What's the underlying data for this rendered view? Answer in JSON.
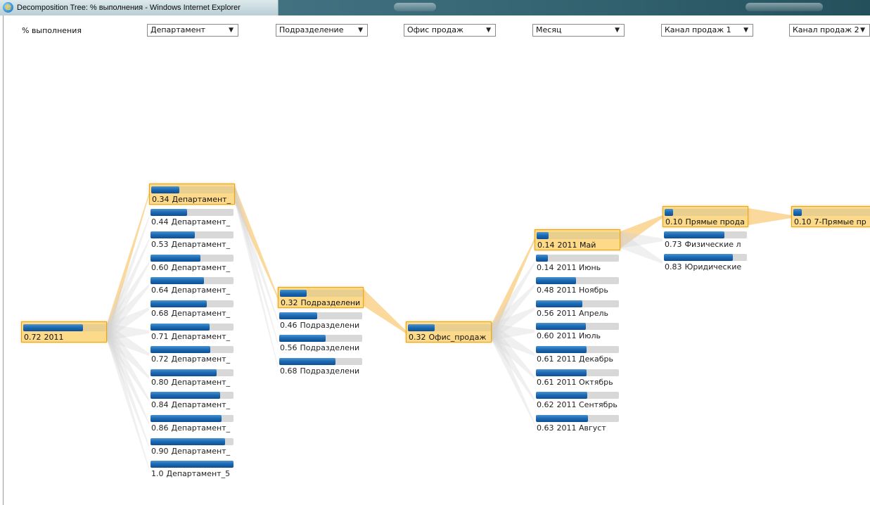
{
  "window": {
    "title": "Decomposition Tree: % выполнения - Windows Internet Explorer",
    "icon": "ie-icon"
  },
  "levels": {
    "measure_label": "% выполнения",
    "dropdowns": [
      {
        "selected": "Департамент"
      },
      {
        "selected": "Подразделение"
      },
      {
        "selected": "Офис продаж"
      },
      {
        "selected": "Месяц"
      },
      {
        "selected": "Канал продаж 1"
      },
      {
        "selected": "Канал продаж 2"
      }
    ]
  },
  "colors": {
    "bar_fill": "#1d6cb4",
    "selected_bg": "#fdd98a",
    "selected_border": "#e9a514",
    "link_selected": "#f7b84a",
    "link_other": "#d4d4d4"
  },
  "tree": {
    "columns": [
      {
        "nodes": [
          {
            "value": "0.72",
            "label": "2011",
            "fraction": 0.72,
            "selected": true
          }
        ]
      },
      {
        "nodes": [
          {
            "value": "0.34",
            "label": "Департамент_",
            "fraction": 0.34,
            "selected": true
          },
          {
            "value": "0.44",
            "label": "Департамент_",
            "fraction": 0.44
          },
          {
            "value": "0.53",
            "label": "Департамент_",
            "fraction": 0.53
          },
          {
            "value": "0.60",
            "label": "Департамент_",
            "fraction": 0.6
          },
          {
            "value": "0.64",
            "label": "Департамент_",
            "fraction": 0.64
          },
          {
            "value": "0.68",
            "label": "Департамент_",
            "fraction": 0.68
          },
          {
            "value": "0.71",
            "label": "Департамент_",
            "fraction": 0.71
          },
          {
            "value": "0.72",
            "label": "Департамент_",
            "fraction": 0.72
          },
          {
            "value": "0.80",
            "label": "Департамент_",
            "fraction": 0.8
          },
          {
            "value": "0.84",
            "label": "Департамент_",
            "fraction": 0.84
          },
          {
            "value": "0.86",
            "label": "Департамент_",
            "fraction": 0.86
          },
          {
            "value": "0.90",
            "label": "Департамент_",
            "fraction": 0.9
          },
          {
            "value": "1.0",
            "label": "Департамент_5",
            "fraction": 1.0
          }
        ]
      },
      {
        "nodes": [
          {
            "value": "0.32",
            "label": "Подразделени",
            "fraction": 0.32,
            "selected": true
          },
          {
            "value": "0.46",
            "label": "Подразделени",
            "fraction": 0.46
          },
          {
            "value": "0.56",
            "label": "Подразделени",
            "fraction": 0.56
          },
          {
            "value": "0.68",
            "label": "Подразделени",
            "fraction": 0.68
          }
        ]
      },
      {
        "nodes": [
          {
            "value": "0.32",
            "label": "Офис_продаж",
            "fraction": 0.32,
            "selected": true
          }
        ]
      },
      {
        "nodes": [
          {
            "value": "0.14",
            "label": "2011 Май",
            "fraction": 0.14,
            "selected": true
          },
          {
            "value": "0.14",
            "label": "2011 Июнь",
            "fraction": 0.14
          },
          {
            "value": "0.48",
            "label": "2011 Ноябрь",
            "fraction": 0.48
          },
          {
            "value": "0.56",
            "label": "2011 Апрель",
            "fraction": 0.56
          },
          {
            "value": "0.60",
            "label": "2011 Июль",
            "fraction": 0.6
          },
          {
            "value": "0.61",
            "label": "2011 Декабрь",
            "fraction": 0.61
          },
          {
            "value": "0.61",
            "label": "2011 Октябрь",
            "fraction": 0.61
          },
          {
            "value": "0.62",
            "label": "2011 Сентябрь",
            "fraction": 0.62
          },
          {
            "value": "0.63",
            "label": "2011 Август",
            "fraction": 0.63
          }
        ]
      },
      {
        "nodes": [
          {
            "value": "0.10",
            "label": "Прямые прода",
            "fraction": 0.1,
            "selected": true
          },
          {
            "value": "0.73",
            "label": "Физические л",
            "fraction": 0.73
          },
          {
            "value": "0.83",
            "label": "Юридические",
            "fraction": 0.83
          }
        ]
      },
      {
        "nodes": [
          {
            "value": "0.10",
            "label": "7-Прямые пр",
            "fraction": 0.1,
            "selected": true
          }
        ]
      }
    ]
  }
}
